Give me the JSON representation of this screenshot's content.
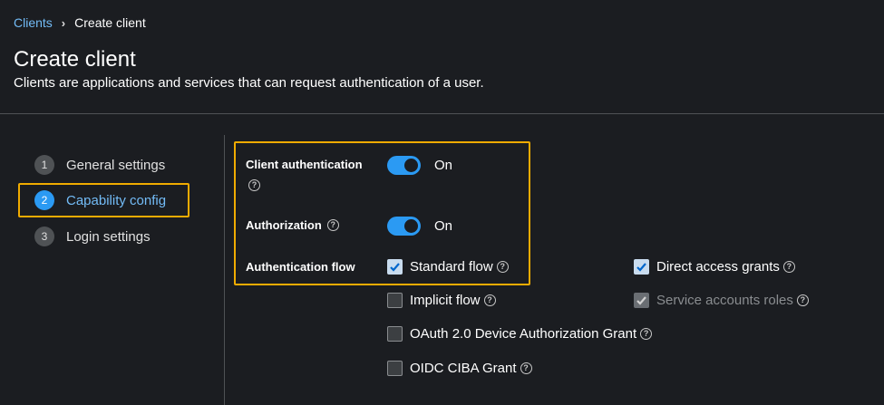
{
  "breadcrumb": {
    "parent": "Clients",
    "separator": "›",
    "current": "Create client"
  },
  "header": {
    "title": "Create client",
    "subtitle": "Clients are applications and services that can request authentication of a user."
  },
  "steps": [
    {
      "number": "1",
      "label": "General settings",
      "active": false
    },
    {
      "number": "2",
      "label": "Capability config",
      "active": true
    },
    {
      "number": "3",
      "label": "Login settings",
      "active": false
    }
  ],
  "form": {
    "client_authentication": {
      "label": "Client authentication",
      "state": "On",
      "enabled": true
    },
    "authorization": {
      "label": "Authorization",
      "state": "On",
      "enabled": true
    },
    "authentication_flow": {
      "label": "Authentication flow",
      "options": {
        "standard_flow": {
          "label": "Standard flow",
          "checked": true
        },
        "direct_access_grants": {
          "label": "Direct access grants",
          "checked": true
        },
        "implicit_flow": {
          "label": "Implicit flow",
          "checked": false
        },
        "service_accounts_roles": {
          "label": "Service accounts roles",
          "checked": true,
          "disabled": true
        },
        "oauth_device_grant": {
          "label": "OAuth 2.0 Device Authorization Grant",
          "checked": false
        },
        "oidc_ciba_grant": {
          "label": "OIDC CIBA Grant",
          "checked": false
        }
      }
    }
  },
  "help_glyph": "?",
  "colors": {
    "background": "#1b1d21",
    "accent": "#2b9af3",
    "link": "#73bcf7",
    "highlight": "#f0ab00"
  }
}
